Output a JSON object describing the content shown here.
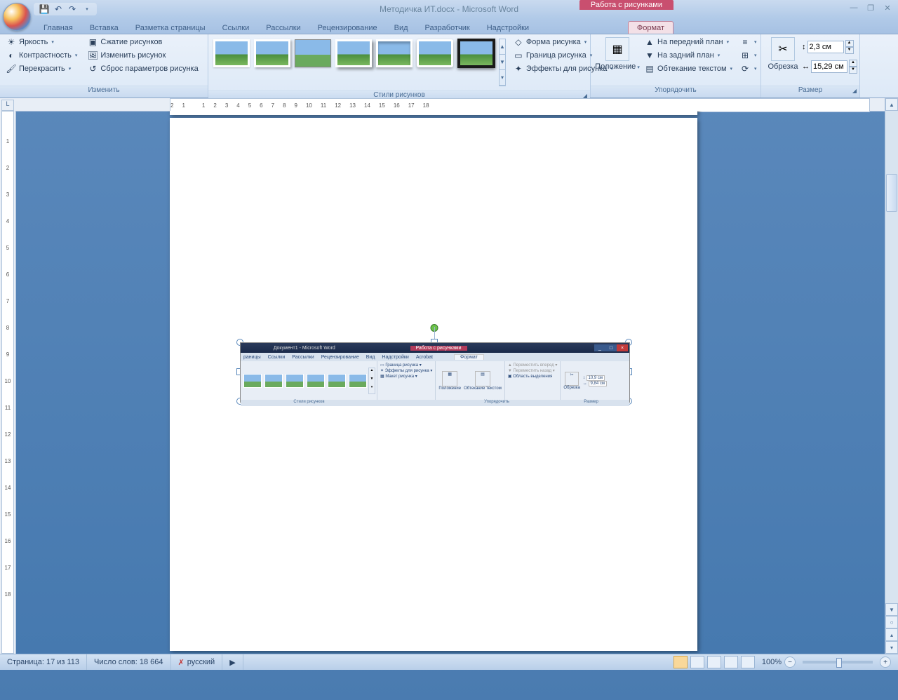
{
  "title": "Методичка ИТ.docx - Microsoft Word",
  "context_tab_header": "Работа с рисунками",
  "tabs": [
    "Главная",
    "Вставка",
    "Разметка страницы",
    "Ссылки",
    "Рассылки",
    "Рецензирование",
    "Вид",
    "Разработчик",
    "Надстройки"
  ],
  "active_tab": "Формат",
  "groups": {
    "adjust": {
      "label": "Изменить",
      "brightness": "Яркость",
      "contrast": "Контрастность",
      "recolor": "Перекрасить",
      "compress": "Сжатие рисунков",
      "change": "Изменить рисунок",
      "reset": "Сброс параметров рисунка"
    },
    "styles": {
      "label": "Стили рисунков",
      "shape": "Форма рисунка",
      "border": "Граница рисунка",
      "effects": "Эффекты для рисунка"
    },
    "arrange": {
      "label": "Упорядочить",
      "position": "Положение",
      "front": "На передний план",
      "back": "На задний план",
      "wrap": "Обтекание текстом"
    },
    "size": {
      "label": "Размер",
      "crop": "Обрезка",
      "height": "2,3 см",
      "width": "15,29 см"
    }
  },
  "inner": {
    "title": "Документ1 - Microsoft Word",
    "context": "Работа с рисунками",
    "tabs": [
      "раницы",
      "Ссылки",
      "Рассылки",
      "Рецензирование",
      "Вид",
      "Надстройки",
      "Acrobat"
    ],
    "active_tab": "Формат",
    "border": "Граница рисунка",
    "effects": "Эффекты для рисунка",
    "layout": "Макет рисунка",
    "position": "Положение",
    "wrap": "Обтекание текстом",
    "front": "Переместить вперед",
    "back": "Переместить назад",
    "selection": "Область выделения",
    "crop": "Обрезка",
    "h": "10,9 см",
    "w": "9,84 см",
    "g_styles": "Стили рисунков",
    "g_arrange": "Упорядочить",
    "g_size": "Размер"
  },
  "status": {
    "page": "Страница: 17 из 113",
    "words": "Число слов: 18 664",
    "lang": "русский",
    "zoom": "100%"
  },
  "ruler_h": [
    "2",
    "1",
    "",
    "1",
    "2",
    "3",
    "4",
    "5",
    "6",
    "7",
    "8",
    "9",
    "10",
    "11",
    "12",
    "13",
    "14",
    "15",
    "16",
    "17",
    "18"
  ],
  "ruler_v": [
    "",
    "1",
    "2",
    "3",
    "4",
    "5",
    "6",
    "7",
    "8",
    "9",
    "10",
    "11",
    "12",
    "13",
    "14",
    "15",
    "16",
    "17",
    "18"
  ]
}
